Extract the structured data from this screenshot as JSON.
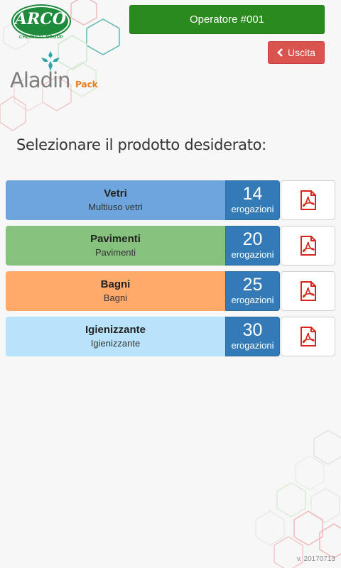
{
  "app": {
    "logo_arco_text": "ARCO",
    "logo_arco_subtitle": "CHEMICAL GROUP",
    "logo_aladin_text": "Aladin",
    "logo_aladin_suffix": "Pack"
  },
  "header": {
    "operator_label": "Operatore #001",
    "exit_label": "Uscita",
    "exit_icon": "chevron-left-icon"
  },
  "prompt": "Selezionare il prodotto desiderato:",
  "products": [
    {
      "name": "Vetri",
      "description": "Multiuso vetri",
      "count": "14",
      "count_label": "erogazioni",
      "color": "#6ea5dc"
    },
    {
      "name": "Pavimenti",
      "description": "Pavimenti",
      "count": "20",
      "count_label": "erogazioni",
      "color": "#86c27d"
    },
    {
      "name": "Bagni",
      "description": "Bagni",
      "count": "25",
      "count_label": "erogazioni",
      "color": "#ffa96b"
    },
    {
      "name": "Igienizzante",
      "description": "Igienizzante",
      "count": "30",
      "count_label": "erogazioni",
      "color": "#b9e3fb"
    }
  ],
  "pdf_icon": "pdf-document-icon",
  "version": "v. 20170713",
  "colors": {
    "operator_green": "#2b8a1d",
    "exit_red": "#d9534f",
    "count_blue": "#337ab7",
    "pdf_red": "#d9231d"
  }
}
